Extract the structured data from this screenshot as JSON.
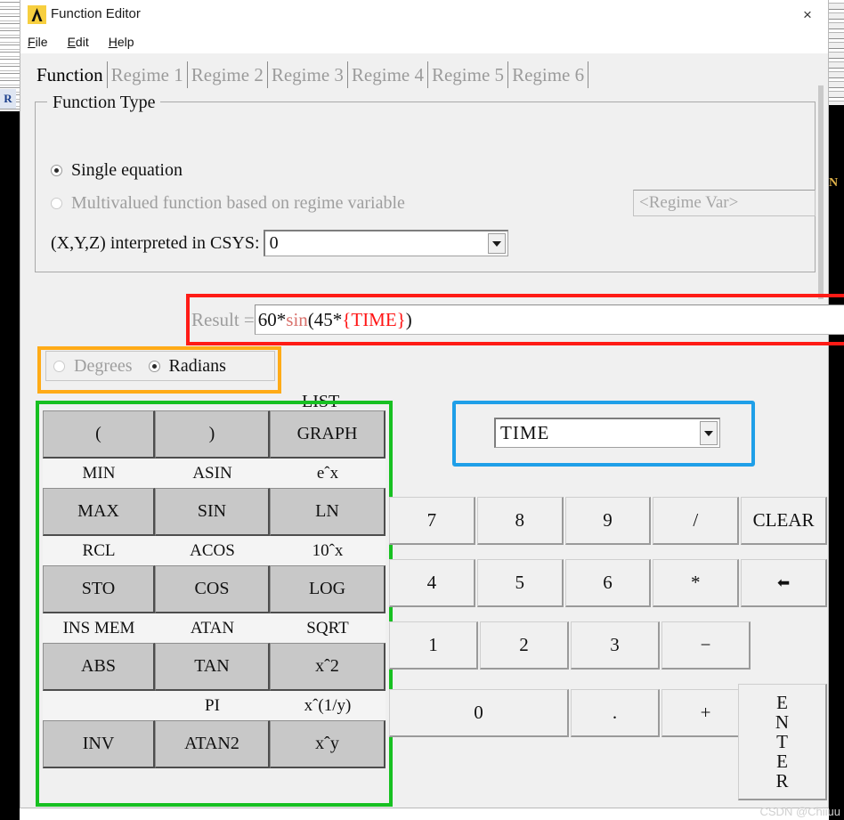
{
  "window": {
    "title": "Function Editor",
    "icon": "lambda-icon",
    "close_label": "×"
  },
  "menubar": {
    "items": [
      {
        "label": "File",
        "mnemonic": "F"
      },
      {
        "label": "Edit",
        "mnemonic": "E"
      },
      {
        "label": "Help",
        "mnemonic": "H"
      }
    ]
  },
  "tabs": [
    {
      "label": "Function",
      "active": true
    },
    {
      "label": "Regime 1",
      "active": false
    },
    {
      "label": "Regime 2",
      "active": false
    },
    {
      "label": "Regime 3",
      "active": false
    },
    {
      "label": "Regime 4",
      "active": false
    },
    {
      "label": "Regime 5",
      "active": false
    },
    {
      "label": "Regime 6",
      "active": false
    }
  ],
  "function_type": {
    "legend": "Function Type",
    "single_equation": {
      "label": "Single equation",
      "selected": true
    },
    "multivalued": {
      "label": "Multivalued function based on regime variable",
      "selected": false
    },
    "regime_var_placeholder": "<Regime Var>",
    "csys_label": "(X,Y,Z) interpreted in CSYS:",
    "csys_value": "0"
  },
  "result": {
    "label": "Result =",
    "value": "60*sin(45*{TIME})",
    "tokens": {
      "pre": "60*",
      "fn": "sin",
      "mid": "(45*",
      "var": "{TIME}",
      "post": ")"
    },
    "highlight_color": "#ff1b16"
  },
  "angle_mode": {
    "degrees": {
      "label": "Degrees",
      "selected": false
    },
    "radians": {
      "label": "Radians",
      "selected": true
    },
    "highlight_color": "#ffab17"
  },
  "list_label": "LIST",
  "variable_selector": {
    "value": "TIME",
    "highlight_color": "#1f9fe8"
  },
  "function_pad": {
    "highlight_color": "#17c021",
    "rows": [
      {
        "buttons": [
          "(",
          ")",
          "GRAPH"
        ],
        "labels": [
          "MIN",
          "ASIN",
          "eˆx"
        ]
      },
      {
        "buttons": [
          "MAX",
          "SIN",
          "LN"
        ],
        "labels": [
          "RCL",
          "ACOS",
          "10ˆx"
        ]
      },
      {
        "buttons": [
          "STO",
          "COS",
          "LOG"
        ],
        "labels": [
          "INS MEM",
          "ATAN",
          "SQRT"
        ]
      },
      {
        "buttons": [
          "ABS",
          "TAN",
          "xˆ2"
        ],
        "labels": [
          "",
          "PI",
          "xˆ(1/y)"
        ]
      },
      {
        "buttons": [
          "INV",
          "ATAN2",
          "xˆy"
        ],
        "labels": []
      }
    ]
  },
  "keypad": {
    "row1": [
      "7",
      "8",
      "9",
      "/",
      "CLEAR"
    ],
    "row2": [
      "4",
      "5",
      "6",
      "*",
      "⬅"
    ],
    "row3": [
      "1",
      "2",
      "3",
      "−"
    ],
    "row4": [
      "0",
      ".",
      "+"
    ],
    "enter_label": "ENTER"
  },
  "background": {
    "left_label": "R",
    "right_label": "N"
  },
  "watermark": "CSDN @Chiiuu"
}
